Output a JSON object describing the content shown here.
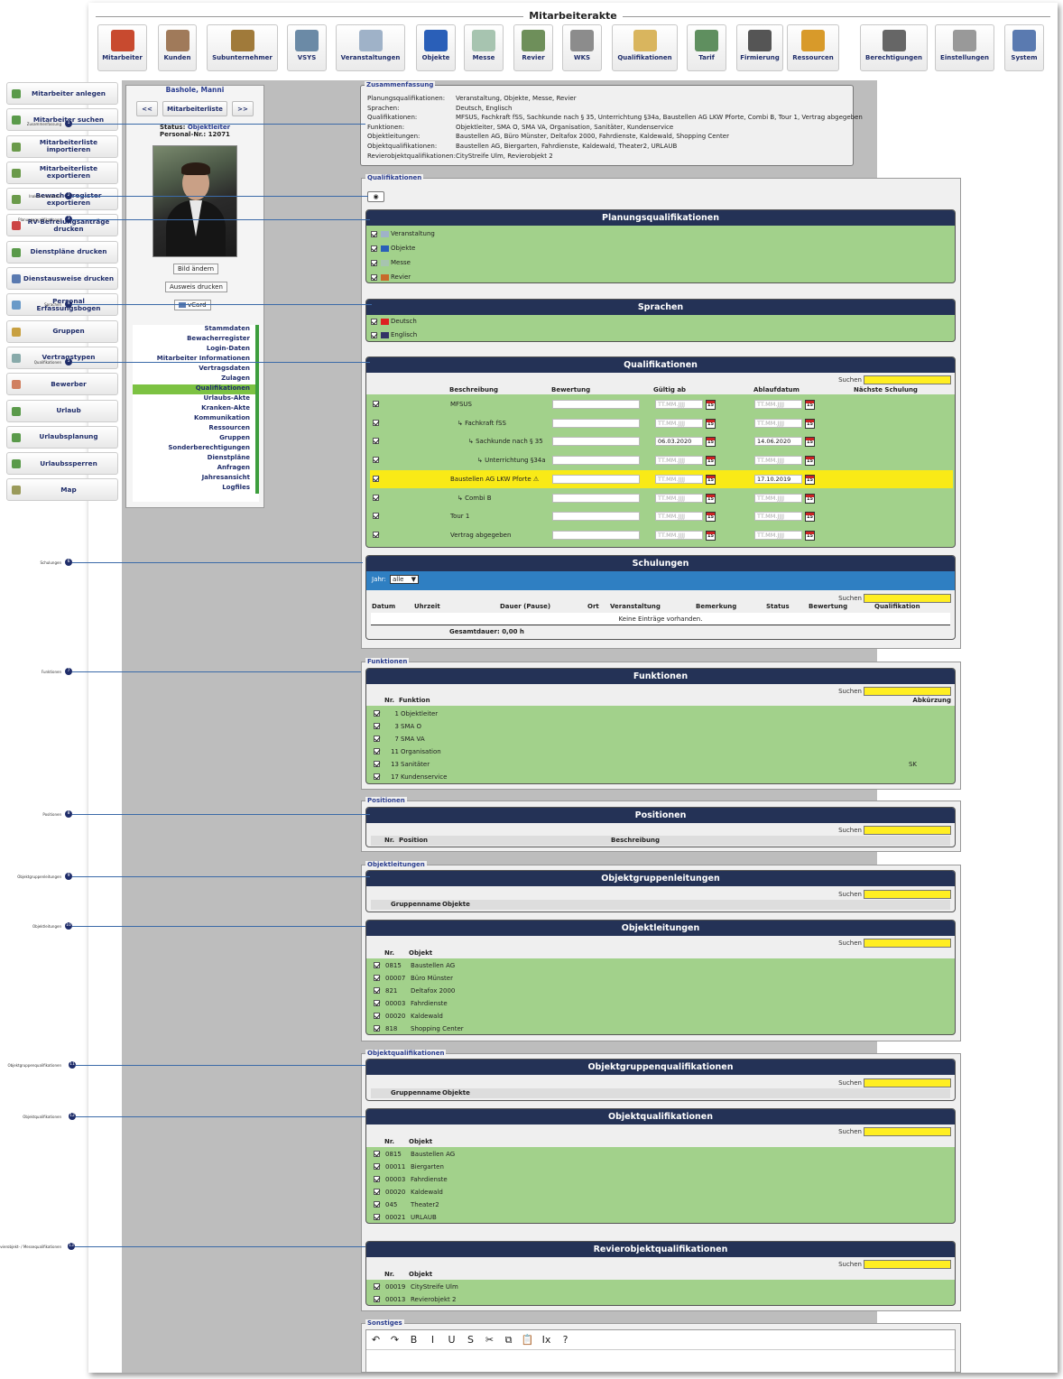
{
  "page_title": "Mitarbeiterakte",
  "toolbar": [
    {
      "label": "Mitarbeiter",
      "icon": "employees-icon",
      "color": "#c84a2f"
    },
    {
      "label": "Kunden",
      "icon": "handshake-icon",
      "color": "#a07a5a"
    },
    {
      "label": "Subunternehmer",
      "icon": "subcontractor-icon",
      "color": "#a07a3a"
    },
    {
      "label": "VSYS",
      "icon": "monitor-icon",
      "color": "#6b8aa6"
    },
    {
      "label": "Veranstaltungen",
      "icon": "event-chart-icon",
      "color": "#9fb2c8"
    },
    {
      "label": "Objekte",
      "icon": "cube-icon",
      "color": "#2a5fb8"
    },
    {
      "label": "Messe",
      "icon": "fair-chart-icon",
      "color": "#a7c4b0"
    },
    {
      "label": "Revier",
      "icon": "district-map-icon",
      "color": "#6e8f5a"
    },
    {
      "label": "WKS",
      "icon": "device-icon",
      "color": "#8c8c8c"
    },
    {
      "label": "Qualifikationen",
      "icon": "certificate-icon",
      "color": "#d9b55e"
    },
    {
      "label": "Tarif",
      "icon": "tariff-icon",
      "color": "#5f8f5f"
    },
    {
      "label": "Firmierung",
      "icon": "phone-icon",
      "color": "#555"
    },
    {
      "label": "Ressourcen",
      "icon": "boxes-icon",
      "color": "#d89a2a"
    },
    {
      "label": "Berechtigungen",
      "icon": "permissions-icon",
      "color": "#666"
    },
    {
      "label": "Einstellungen",
      "icon": "wrench-icon",
      "color": "#999"
    },
    {
      "label": "System",
      "icon": "gears-icon",
      "color": "#5a7ab0"
    }
  ],
  "leftnav": [
    "Mitarbeiter anlegen",
    "Mitarbeiter suchen",
    "Mitarbeiterliste importieren",
    "Mitarbeiterliste exportieren",
    "Bewacherregister exportieren",
    "RV-Befreiungsanträge drucken",
    "Dienstpläne drucken",
    "Dienstausweise drucken",
    "Personal Erfassungsbogen",
    "Gruppen",
    "Vertragstypen",
    "Bewerber",
    "Urlaub",
    "Urlaubsplanung",
    "Urlaubssperren",
    "Map"
  ],
  "employee": {
    "name": "Bashole, Manni",
    "prev": "<<",
    "list": "Mitarbeiterliste",
    "next": ">>",
    "status_label": "Status:",
    "status_value": "Objektleiter",
    "pnr_label": "Personal-Nr.:",
    "pnr_value": "12071",
    "btn_image": "Bild ändern",
    "btn_print": "Ausweis drucken",
    "btn_vcard": "vCard",
    "tabs": [
      "Stammdaten",
      "Bewacherregister",
      "Login-Daten",
      "Mitarbeiter Informationen",
      "Vertragsdaten",
      "Zulagen",
      "Qualifikationen",
      "Urlaubs-Akte",
      "Kranken-Akte",
      "Kommunikation",
      "Ressourcen",
      "Gruppen",
      "Sonderberechtigungen",
      "Dienstpläne",
      "Anfragen",
      "Jahresansicht",
      "Logfiles"
    ],
    "active_tab": "Qualifikationen"
  },
  "summary": {
    "legend": "Zusammenfassung",
    "rows": [
      {
        "k": "Planungsqualifikationen:",
        "v": "Veranstaltung, Objekte, Messe, Revier"
      },
      {
        "k": "Sprachen:",
        "v": "Deutsch, Englisch"
      },
      {
        "k": "Qualifikationen:",
        "v": "MFSUS, Fachkraft fSS, Sachkunde nach § 35, Unterrichtung §34a, Baustellen AG LKW Pforte, Combi B, Tour 1, Vertrag abgegeben"
      },
      {
        "k": "Funktionen:",
        "v": "Objektleiter, SMA O, SMA VA, Organisation, Sanitäter, Kundenservice"
      },
      {
        "k": "Objektleitungen:",
        "v": "Baustellen AG, Büro Münster, Deltafox 2000, Fahrdienste, Kaldewald, Shopping Center"
      },
      {
        "k": "Objektqualifikationen:",
        "v": "Baustellen AG, Biergarten, Fahrdienste, Kaldewald, Theater2, URLAUB"
      },
      {
        "k": "Revierobjektqualifikationen:",
        "v": "CityStreife Ulm, Revierobjekt 2"
      }
    ]
  },
  "search_label": "Suchen",
  "qual_section": {
    "legend": "Qualifikationen",
    "planning_title": "Planungsqualifikationen",
    "planning": [
      "Veranstaltung",
      "Objekte",
      "Messe",
      "Revier"
    ],
    "lang_title": "Sprachen",
    "languages": [
      "Deutsch",
      "Englisch"
    ],
    "qual_title": "Qualifikationen",
    "cols": [
      "Beschreibung",
      "Bewertung",
      "Gültig ab",
      "Ablaufdatum",
      "Nächste Schulung"
    ],
    "date_placeholder": "TT.MM.JJJJ",
    "rows": [
      {
        "name": "MFSUS",
        "valid": "",
        "expire": ""
      },
      {
        "name": "↳ Fachkraft fSS",
        "valid": "",
        "expire": ""
      },
      {
        "name": "↳ Sachkunde nach § 35",
        "valid": "06.03.2020",
        "expire": "14.06.2020"
      },
      {
        "name": "↳ Unterrichtung §34a",
        "valid": "",
        "expire": ""
      },
      {
        "name": "Baustellen AG LKW Pforte ⚠",
        "valid": "",
        "expire": "17.10.2019"
      },
      {
        "name": "↳ Combi B",
        "valid": "",
        "expire": ""
      },
      {
        "name": "Tour 1",
        "valid": "",
        "expire": ""
      },
      {
        "name": "Vertrag abgegeben",
        "valid": "",
        "expire": ""
      }
    ],
    "cal_label": "15",
    "training_title": "Schulungen",
    "year_label": "Jahr:",
    "year_value": "alle",
    "training_cols": [
      "Datum",
      "Uhrzeit",
      "Dauer (Pause)",
      "Ort",
      "Veranstaltung",
      "Bemerkung",
      "Status",
      "Bewertung",
      "Qualifikation"
    ],
    "no_entries": "Keine Einträge vorhanden.",
    "total_label": "Gesamtdauer:",
    "total_value": "0,00 h"
  },
  "functions": {
    "legend": "Funktionen",
    "title": "Funktionen",
    "cols": [
      "Nr.",
      "Funktion",
      "Abkürzung"
    ],
    "rows": [
      [
        "1",
        "Objektleiter",
        ""
      ],
      [
        "3",
        "SMA O",
        ""
      ],
      [
        "7",
        "SMA VA",
        ""
      ],
      [
        "11",
        "Organisation",
        ""
      ],
      [
        "13",
        "Sanitäter",
        "SK"
      ],
      [
        "17",
        "Kundenservice",
        ""
      ]
    ]
  },
  "positions": {
    "legend": "Positionen",
    "title": "Positionen",
    "cols": [
      "Nr.",
      "Position",
      "Beschreibung"
    ]
  },
  "objleads": {
    "legend": "Objektleitungen",
    "group_title": "Objektgruppenleitungen",
    "group_cols": [
      "Gruppenname",
      "Objekte"
    ],
    "title": "Objektleitungen",
    "cols": [
      "Nr.",
      "Objekt"
    ],
    "rows": [
      [
        "0815",
        "Baustellen AG"
      ],
      [
        "00007",
        "Büro Münster"
      ],
      [
        "821",
        "Deltafox 2000"
      ],
      [
        "00003",
        "Fahrdienste"
      ],
      [
        "00020",
        "Kaldewald"
      ],
      [
        "818",
        "Shopping Center"
      ]
    ]
  },
  "objquals": {
    "legend": "Objektqualifikationen",
    "group_title": "Objektgruppenqualifikationen",
    "group_cols": [
      "Gruppenname",
      "Objekte"
    ],
    "title": "Objektqualifikationen",
    "cols": [
      "Nr.",
      "Objekt"
    ],
    "rows": [
      [
        "0815",
        "Baustellen AG"
      ],
      [
        "00011",
        "Biergarten"
      ],
      [
        "00003",
        "Fahrdienste"
      ],
      [
        "00020",
        "Kaldewald"
      ],
      [
        "045",
        "Theater2"
      ],
      [
        "00021",
        "URLAUB"
      ]
    ],
    "rev_title": "Revierobjektqualifikationen",
    "rev_rows": [
      [
        "00019",
        "CityStreife Ulm"
      ],
      [
        "00013",
        "Revierobjekt 2"
      ]
    ]
  },
  "other": {
    "legend": "Sonstiges",
    "tools": [
      "↶",
      "↷",
      "B",
      "I",
      "U",
      "S",
      "✂",
      "⧉",
      "📋",
      "Ix",
      "?"
    ]
  },
  "annotations": [
    {
      "label": "Zusammenfassung",
      "n": "1"
    },
    {
      "label": "Inaktive Ausblden",
      "n": "2"
    },
    {
      "label": "Planungsqualifikationen",
      "n": "3"
    },
    {
      "label": "Sprachen",
      "n": "4"
    },
    {
      "label": "Qualifikationen",
      "n": "5"
    },
    {
      "label": "Schulungen",
      "n": "6"
    },
    {
      "label": "Funktionen",
      "n": "7"
    },
    {
      "label": "Positionen",
      "n": "8"
    },
    {
      "label": "Objektgruppenleitungen",
      "n": "9"
    },
    {
      "label": "Objektleitungen",
      "n": "10"
    },
    {
      "label": "Objektgruppenqualifikationen",
      "n": "11"
    },
    {
      "label": "Objektqualifikationen",
      "n": "12"
    },
    {
      "label": "Revierobjekt- / Messequalifikationen",
      "n": "13"
    }
  ]
}
